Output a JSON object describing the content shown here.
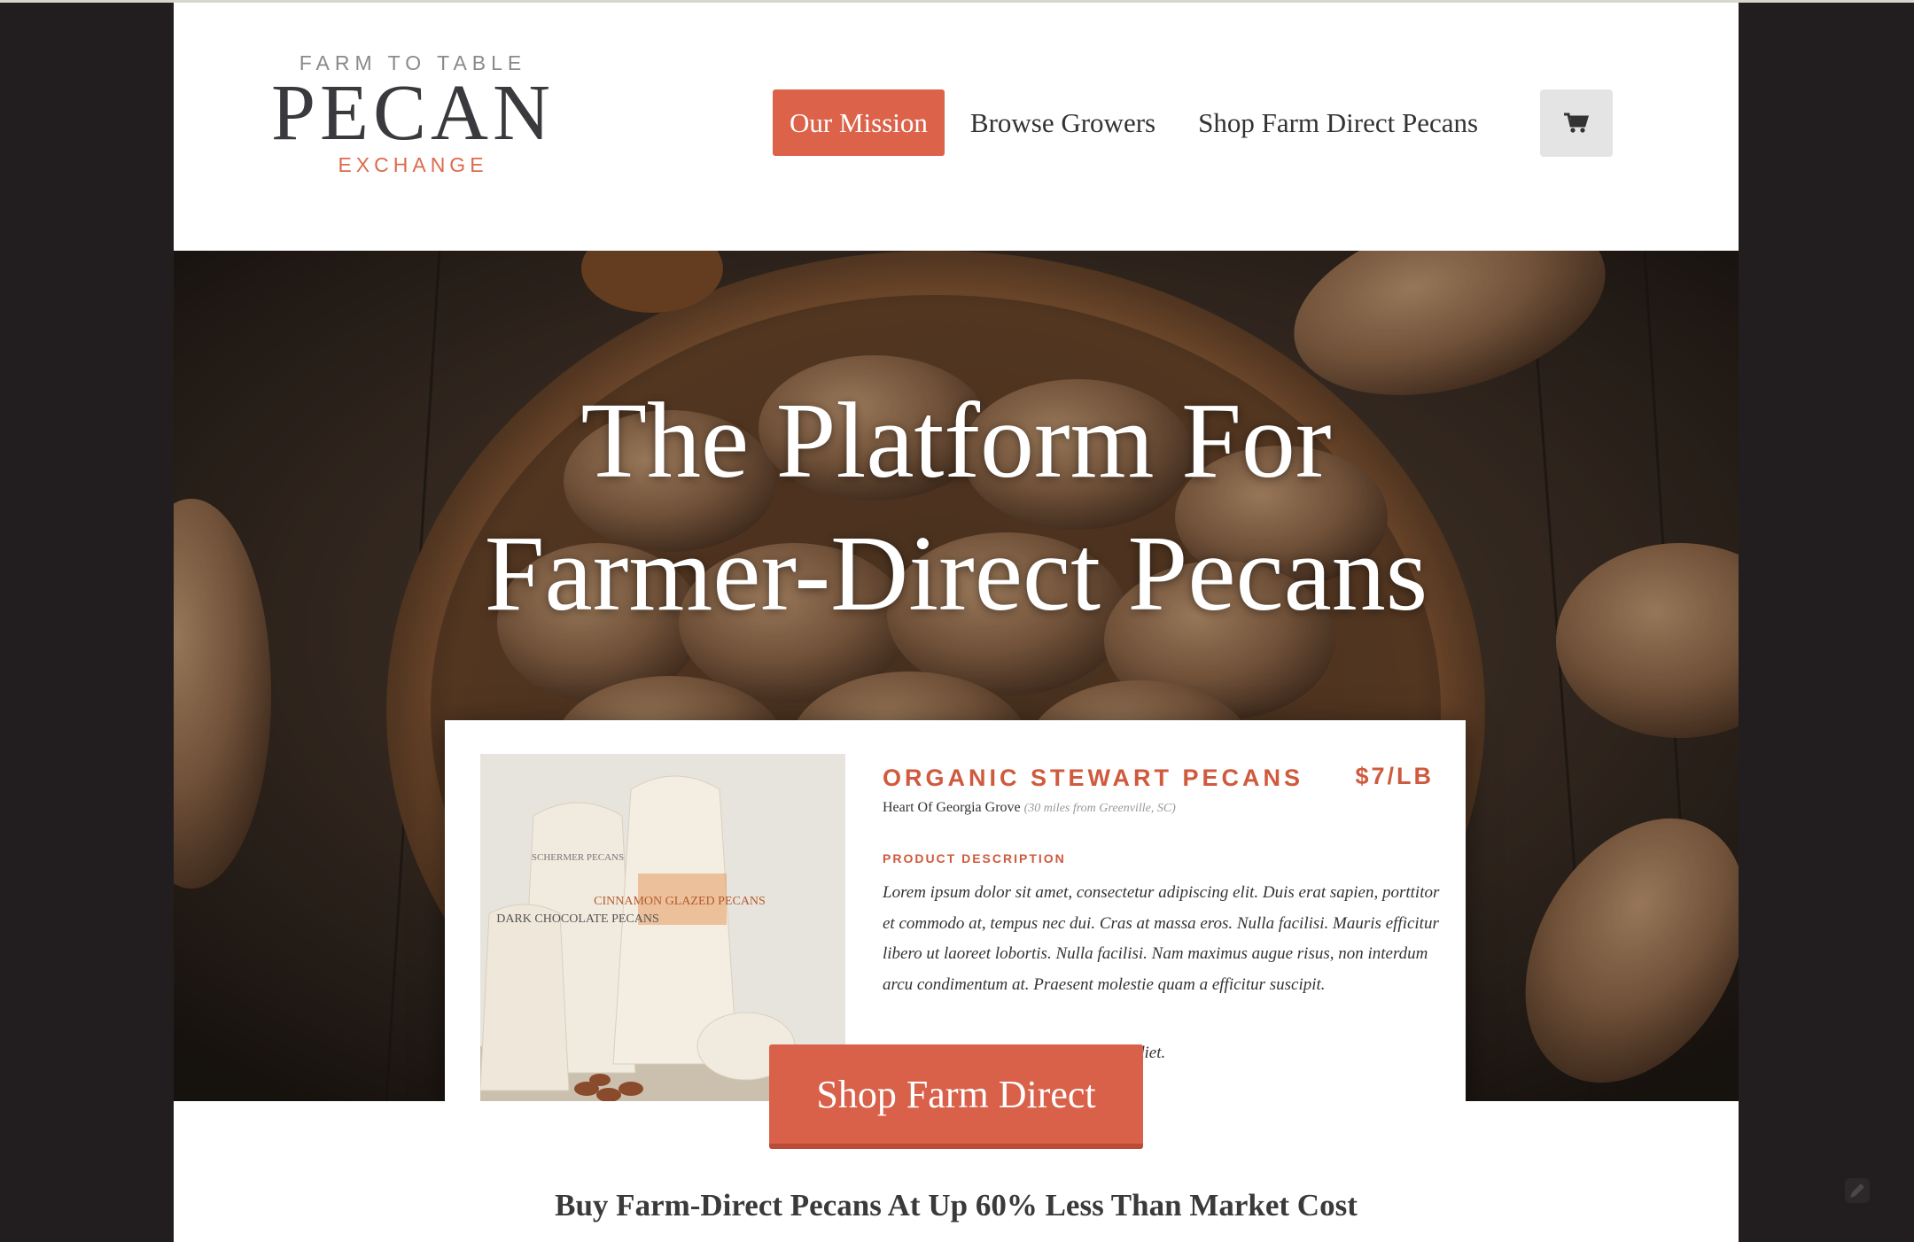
{
  "logo": {
    "top": "FARM TO TABLE",
    "main": "PECAN",
    "bottom": "EXCHANGE"
  },
  "nav": {
    "items": [
      {
        "label": "Our Mission",
        "active": true
      },
      {
        "label": "Browse Growers",
        "active": false
      },
      {
        "label": "Shop Farm Direct Pecans",
        "active": false
      }
    ],
    "cart_icon": "shopping-cart-icon"
  },
  "hero": {
    "title_line1": "The Platform For",
    "title_line2": "Farmer-Direct Pecans"
  },
  "product_card": {
    "name": "ORGANIC STEWART PECANS",
    "price": "$7/LB",
    "grove": "Heart Of Georgia Grove",
    "distance": "(30 miles from Greenville, SC)",
    "description_label": "PRODUCT DESCRIPTION",
    "description": "Lorem ipsum dolor sit amet, consectetur adipiscing elit. Duis erat sapien, porttitor et commodo at, tempus nec dui. Cras at massa eros. Nulla facilisi. Mauris efficitur libero ut laoreet lobortis. Nulla facilisi. Nam maximus augue risus, non interdum arcu condimentum at. Praesent molestie quam a efficitur suscipit.",
    "description_tail": "diet.",
    "bag_labels": {
      "brand": "SCHERMER PECANS",
      "bag1": "DARK CHOCOLATE PECANS",
      "bag2": "CINNAMON GLAZED PECANS"
    }
  },
  "cta": {
    "label": "Shop Farm Direct"
  },
  "tagline": "Buy Farm-Direct Pecans At Up 60% Less Than Market Cost",
  "colors": {
    "accent": "#dc634a",
    "dark_bg": "#221e20",
    "logo_text": "#3a3a3e"
  }
}
